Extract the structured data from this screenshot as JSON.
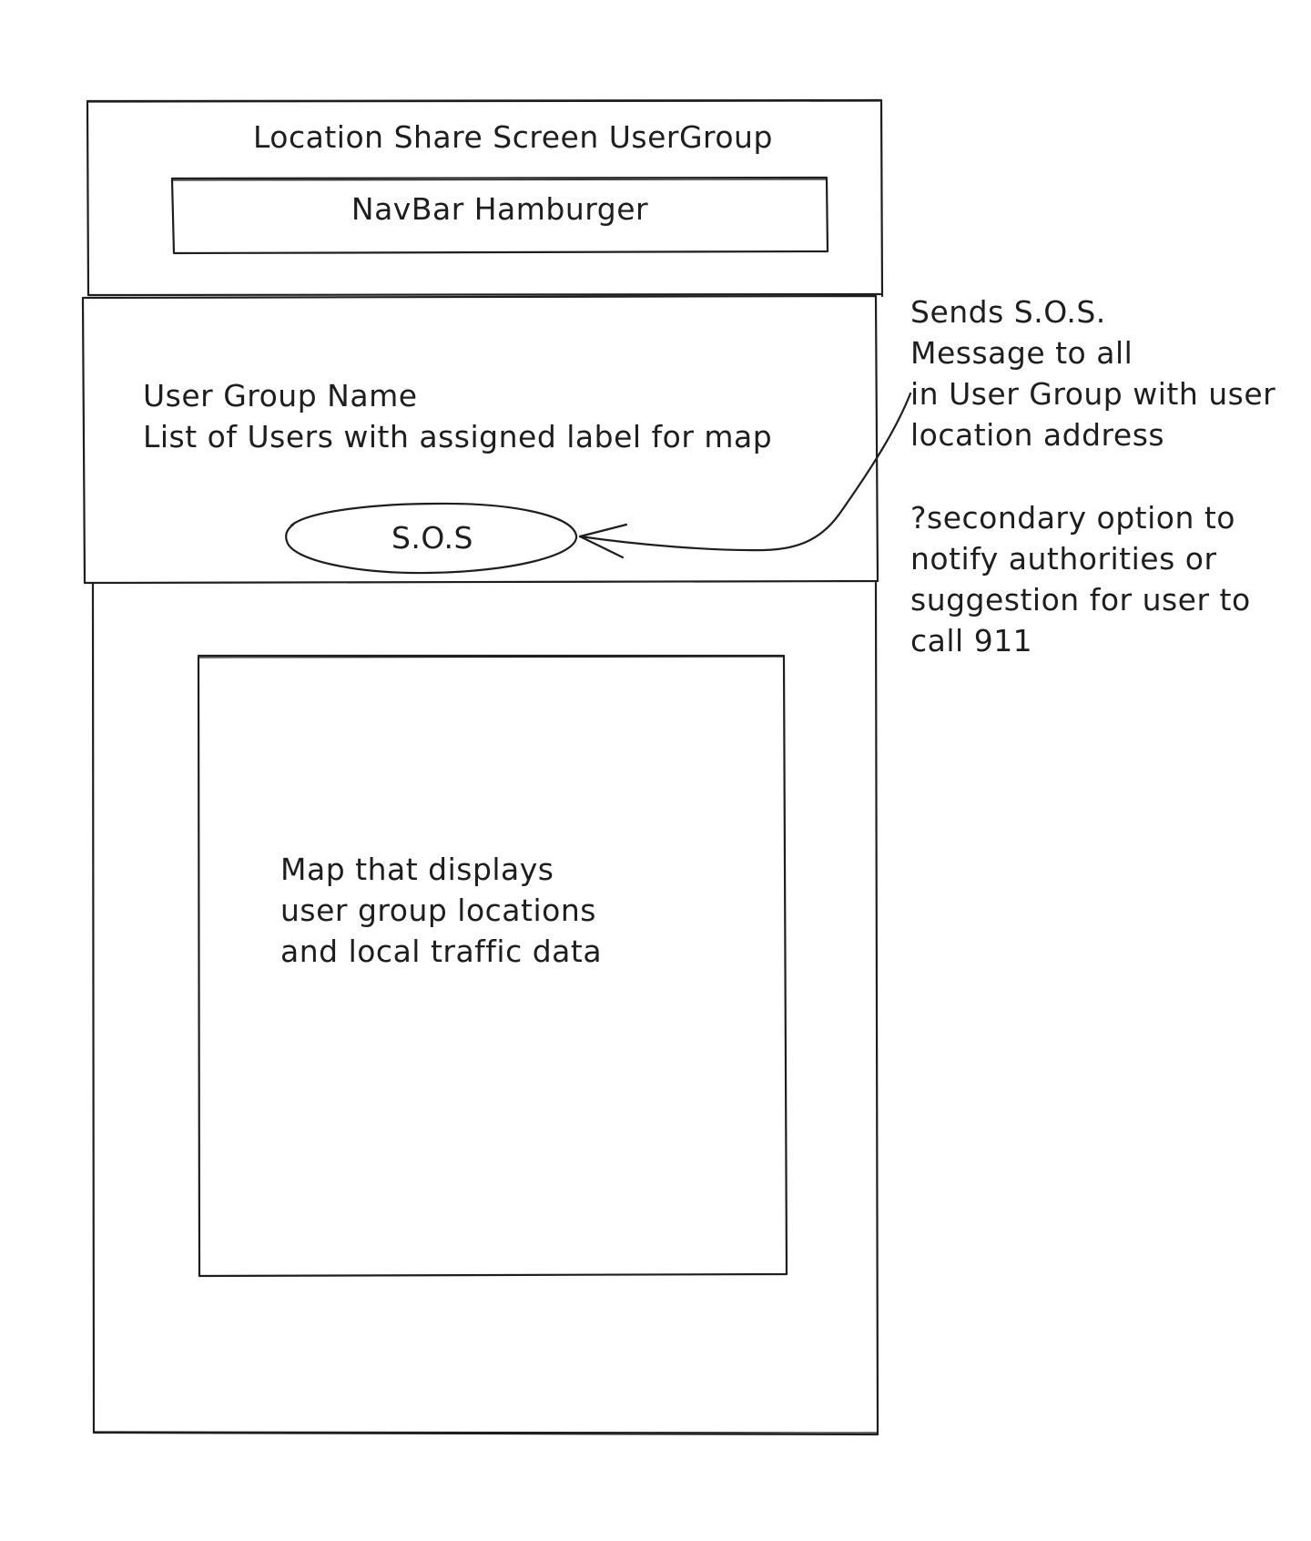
{
  "header": {
    "title": "Location Share Screen UserGroup",
    "navbar_label": "NavBar Hamburger"
  },
  "group_panel": {
    "line1": "User Group Name",
    "line2": "List of Users with assigned label for map",
    "sos_button_label": "S.O.S"
  },
  "map_panel": {
    "line1": "Map that displays",
    "line2": "user group locations",
    "line3": "and local traffic data"
  },
  "annotation": {
    "sos_note": [
      "Sends S.O.S.",
      "Message to all",
      "in User Group with user",
      "location address"
    ],
    "secondary_note": [
      "?secondary option to",
      "notify authorities or",
      "suggestion for user to",
      "call 911"
    ]
  },
  "colors": {
    "stroke": "#1e1e1e",
    "background": "#ffffff"
  }
}
